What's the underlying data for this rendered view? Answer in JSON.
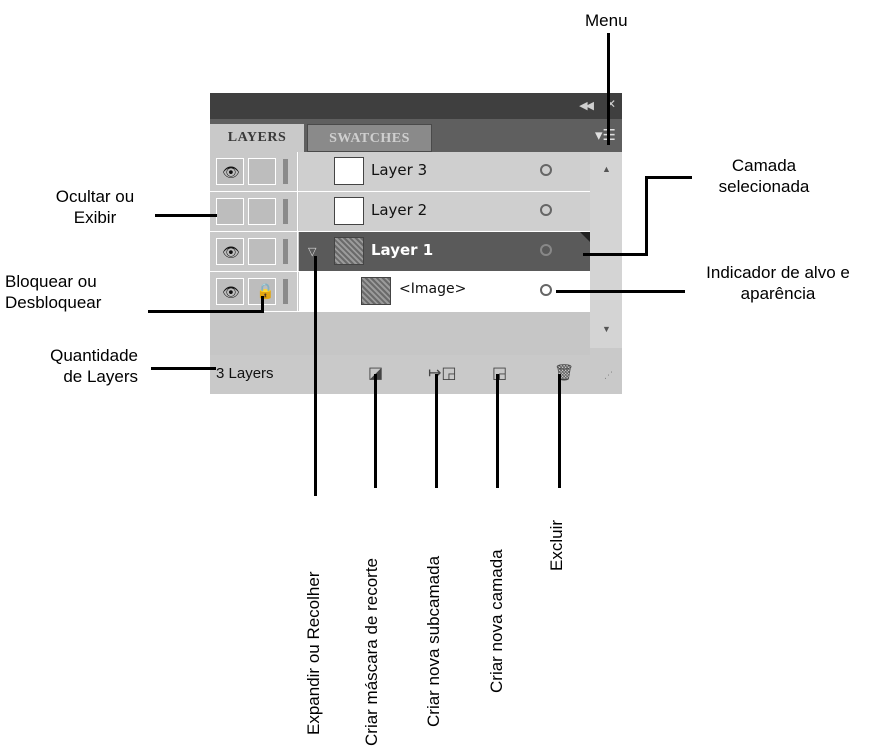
{
  "panel": {
    "tabs": [
      "LAYERS",
      "SWATCHES"
    ],
    "layers": [
      {
        "name": "Layer 3",
        "visible": true,
        "locked": false,
        "thumb": "blank",
        "selected": false
      },
      {
        "name": "Layer 2",
        "visible": false,
        "locked": false,
        "thumb": "blank",
        "selected": false
      },
      {
        "name": "Layer 1",
        "visible": true,
        "locked": false,
        "thumb": "image",
        "selected": true,
        "expanded": true
      },
      {
        "name": "<Image>",
        "visible": true,
        "locked": true,
        "thumb": "image",
        "selected": false,
        "sublayer": true
      }
    ],
    "footer": {
      "count": "3 Layers"
    }
  },
  "annotations": {
    "menu": "Menu",
    "camada_selecionada": [
      "Camada",
      "selecionada"
    ],
    "ocultar": [
      "Ocultar ou",
      "Exibir"
    ],
    "bloquear": [
      "Bloquear ou",
      "Desbloquear"
    ],
    "indicador": [
      "Indicador de alvo e",
      "aparência"
    ],
    "quantidade": [
      "Quantidade",
      "de Layers"
    ],
    "expandir": "Expandir ou  Recolher",
    "mascara": "Criar máscara de recorte",
    "subcamada": "Criar nova subcamada",
    "nova_camada": "Criar nova camada",
    "excluir": "Excluir"
  }
}
